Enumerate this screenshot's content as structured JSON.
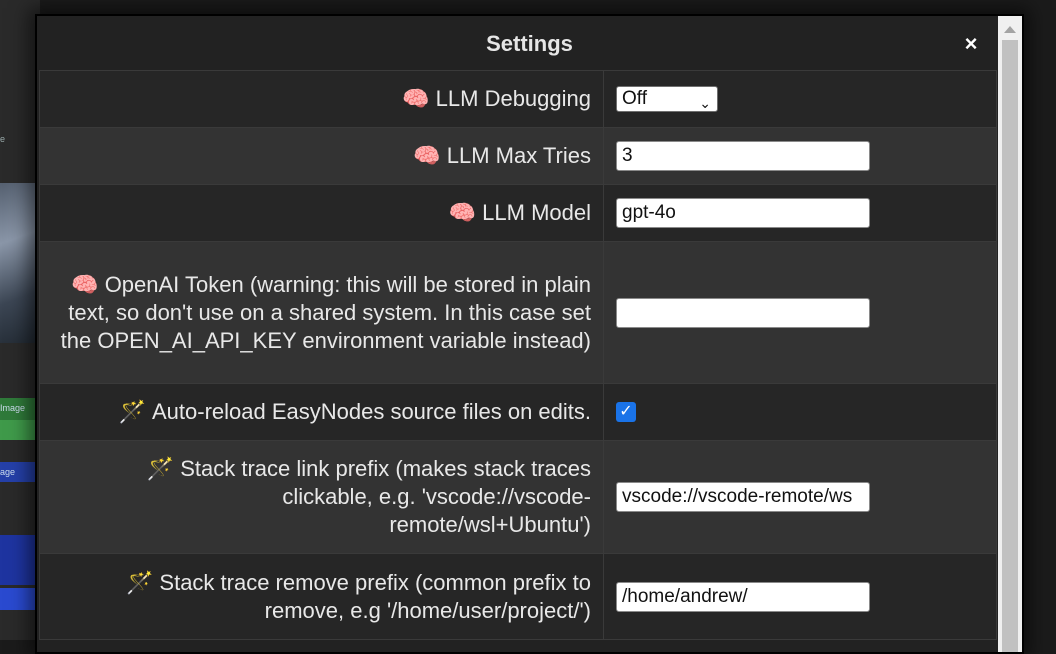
{
  "background": {
    "hint_e": "e",
    "hint_image": "Image",
    "hint_age": "age"
  },
  "dialog": {
    "title": "Settings",
    "close_icon": "×"
  },
  "rows": [
    {
      "icon": "brain-icon",
      "label": "LLM Debugging",
      "control": "select",
      "value": "Off"
    },
    {
      "icon": "brain-icon",
      "label": "LLM Max Tries",
      "control": "text",
      "value": "3"
    },
    {
      "icon": "brain-icon",
      "label": "LLM Model",
      "control": "text",
      "value": "gpt-4o"
    },
    {
      "icon": "brain-icon",
      "label": "OpenAI Token (warning: this will be stored in plain text, so don't use on a shared system. In this case set the OPEN_AI_API_KEY environment variable instead)",
      "control": "text",
      "value": ""
    },
    {
      "icon": "magic-wand-icon",
      "label": "Auto-reload EasyNodes source files on edits.",
      "control": "checkbox",
      "checked": true
    },
    {
      "icon": "magic-wand-icon",
      "label": "Stack trace link prefix (makes stack traces clickable, e.g. 'vscode://vscode-remote/wsl+Ubuntu')",
      "control": "text",
      "value": "vscode://vscode-remote/ws"
    },
    {
      "icon": "magic-wand-icon",
      "label": "Stack trace remove prefix (common prefix to remove, e.g '/home/user/project/')",
      "control": "text",
      "value": "/home/andrew/"
    }
  ],
  "glyphs": {
    "brain": "🧠",
    "wand": "🪄",
    "check": "✓",
    "chevron": "⌄"
  }
}
